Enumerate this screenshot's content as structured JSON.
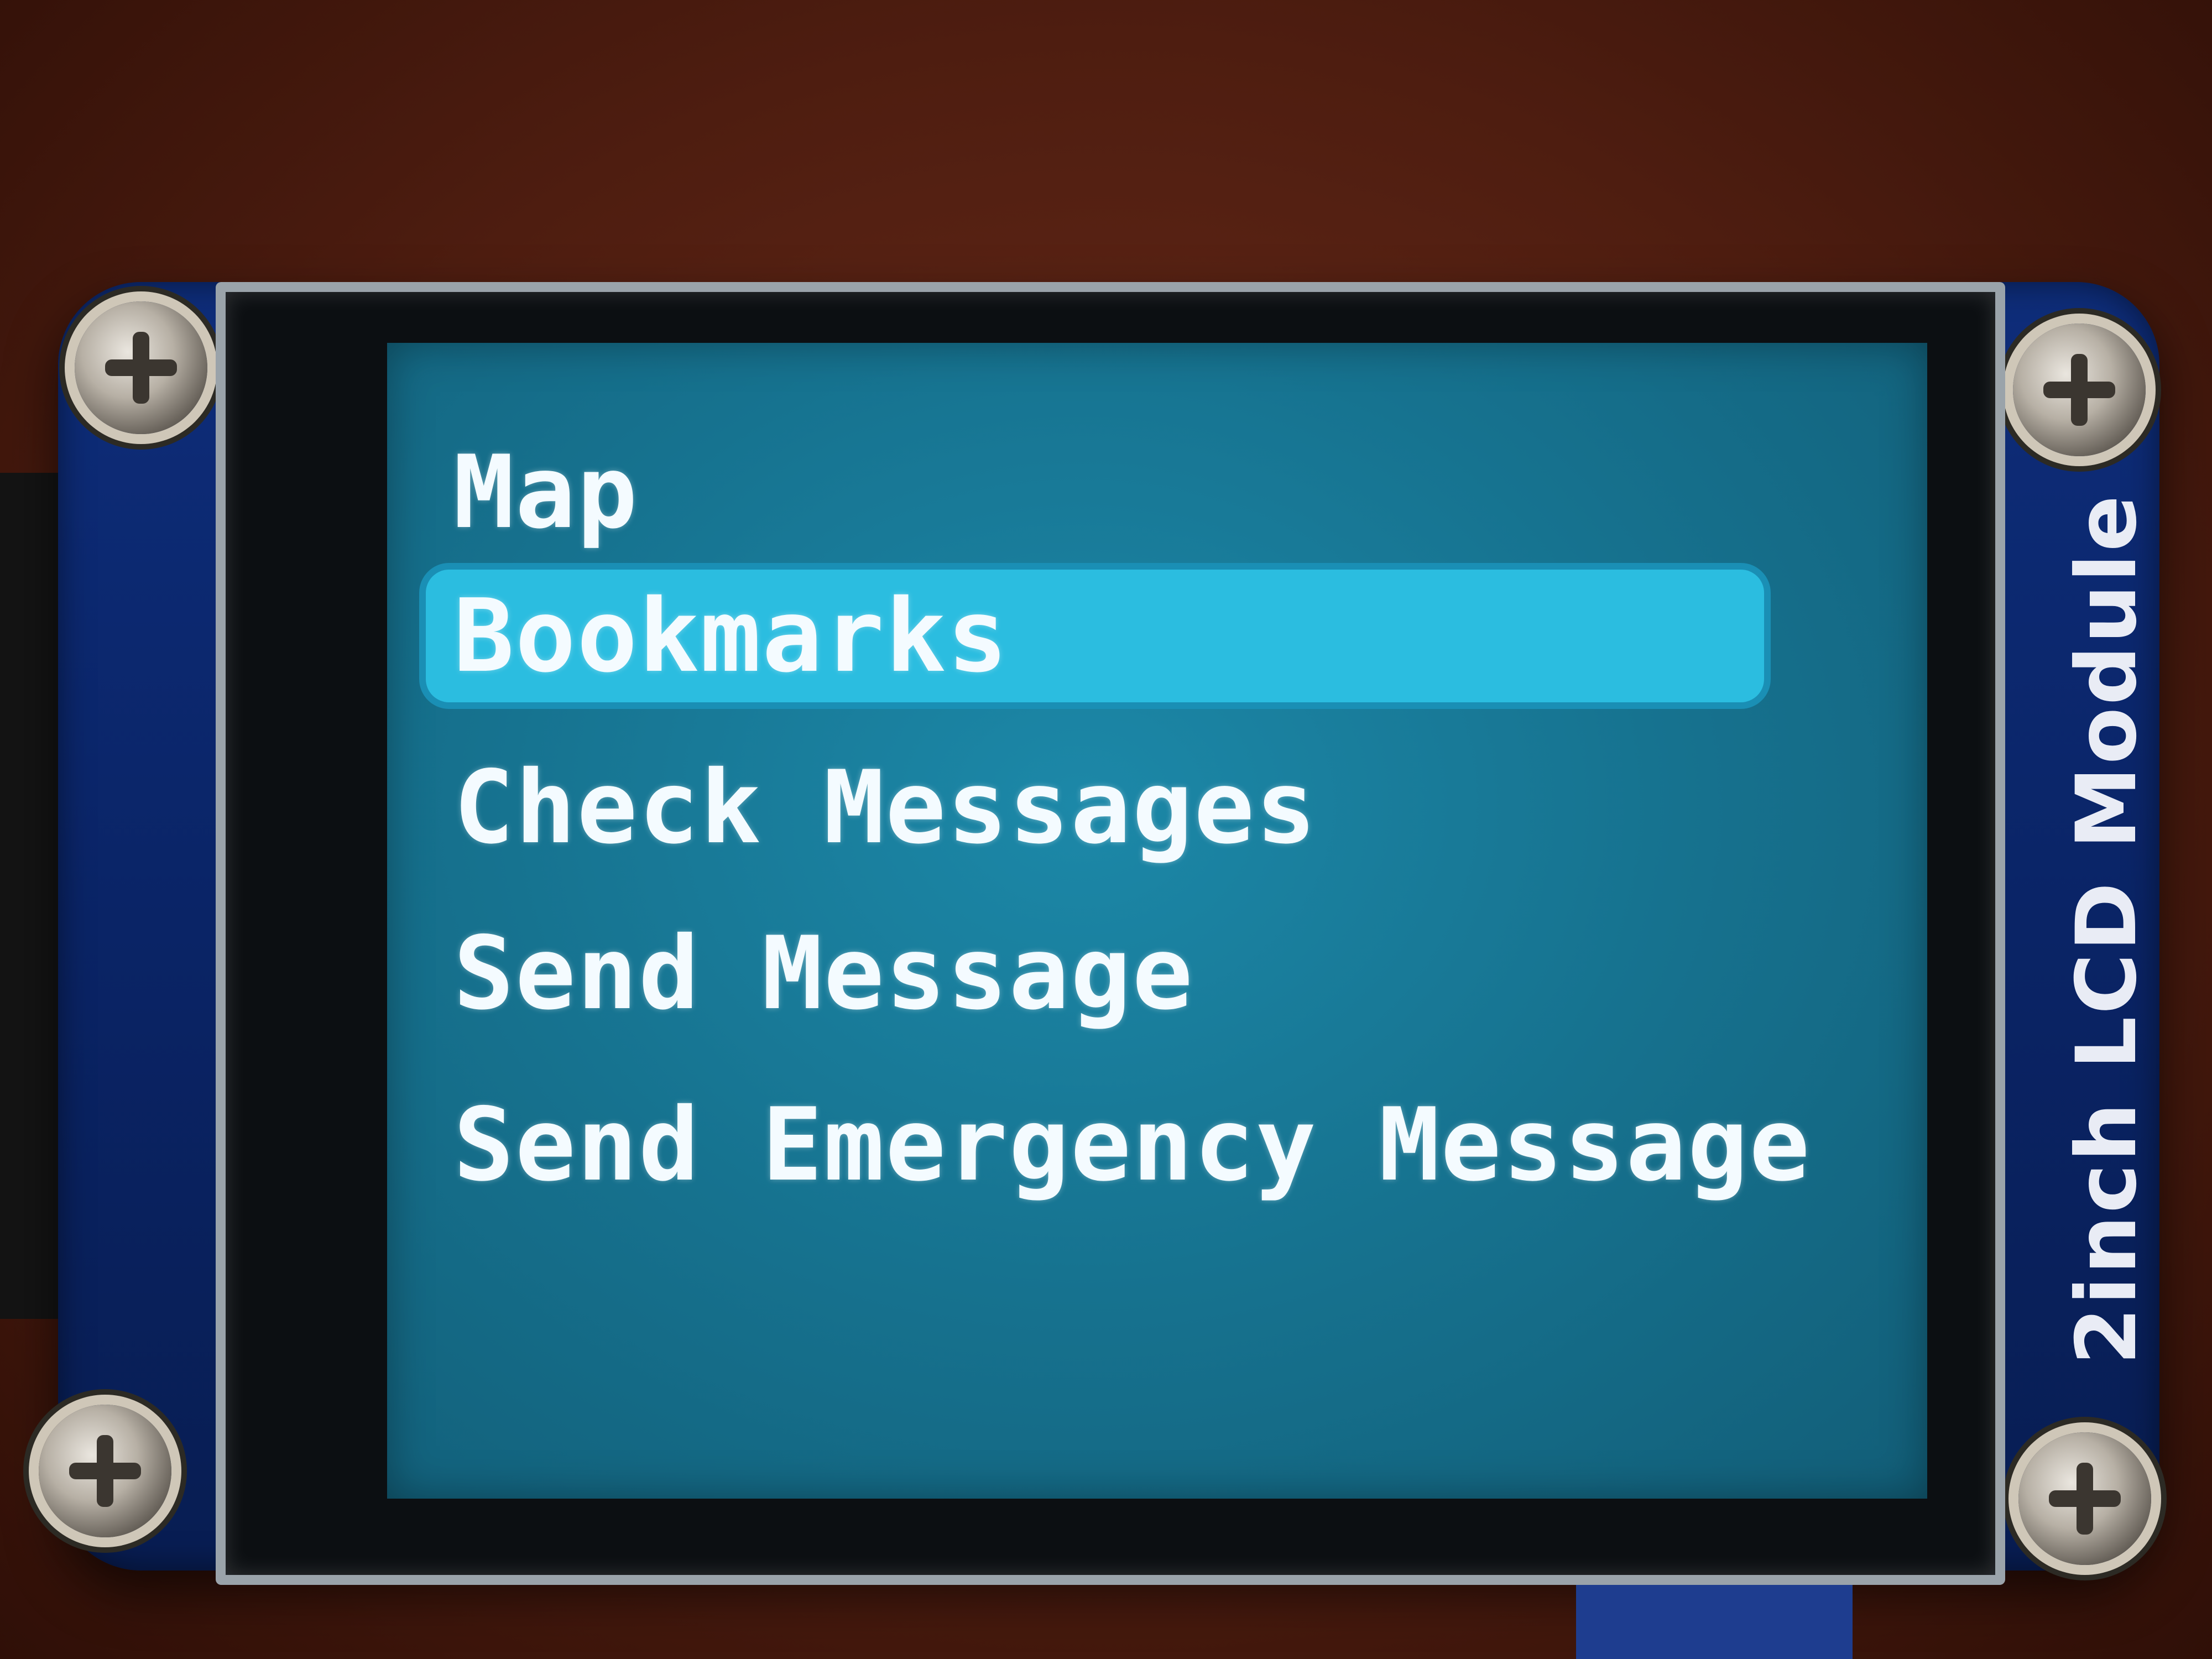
{
  "device": {
    "module_label": "2inch LCD Module"
  },
  "menu": {
    "items": [
      {
        "label": "Map",
        "selected": false
      },
      {
        "label": "Bookmarks",
        "selected": true
      },
      {
        "label": "Check Messages",
        "selected": false
      },
      {
        "label": "Send Message",
        "selected": false
      },
      {
        "label": "Send Emergency Message",
        "selected": false
      }
    ]
  },
  "colors": {
    "screen_background": "#16728f",
    "selection_highlight": "#2bbde0",
    "text": "#f4fbff",
    "board": "#0a2466"
  }
}
